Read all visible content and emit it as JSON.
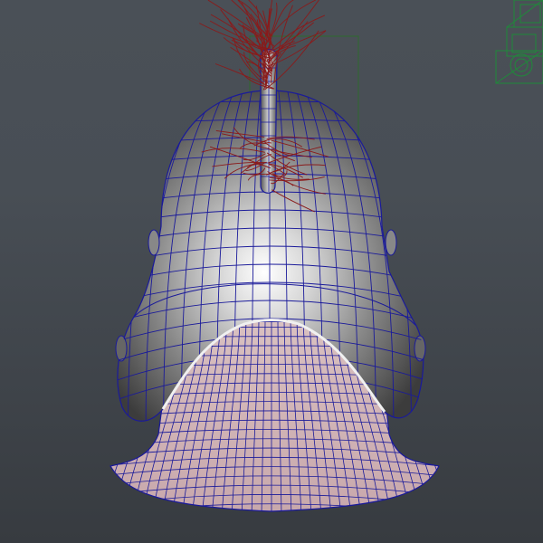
{
  "viewport": {
    "background_top": "#4a5057",
    "background_bottom": "#373b40"
  },
  "scene": {
    "objects": [
      {
        "name": "helmet",
        "wire_color": "#1a1a9a",
        "shade_light": "#f2f2f2",
        "shade_dark": "#3a3a3a"
      },
      {
        "name": "neck-guard",
        "wire_color": "#1a1a9a",
        "shade_color": "#d8b8b8"
      },
      {
        "name": "plume",
        "curve_color": "#8a1a1a"
      },
      {
        "name": "bounding-box",
        "wire_color": "#2e6a2e"
      },
      {
        "name": "secondary-object",
        "wire_color": "#1f8a3a"
      }
    ]
  }
}
